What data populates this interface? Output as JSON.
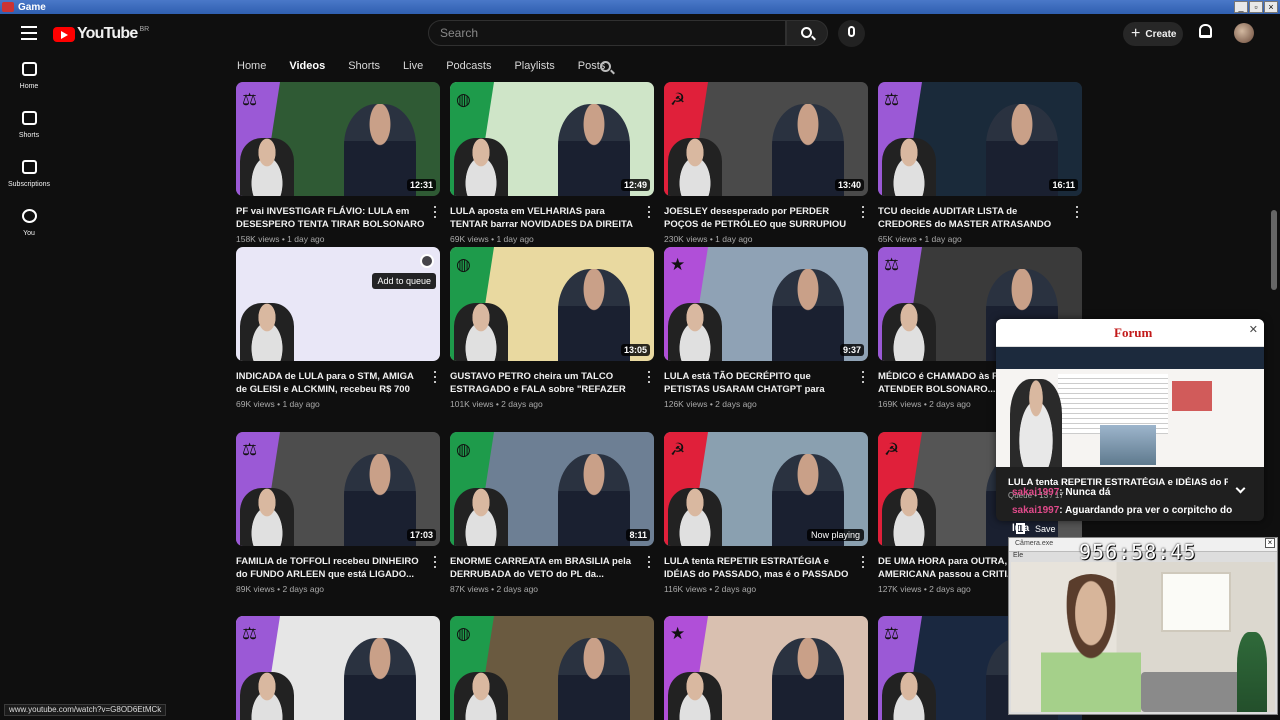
{
  "os": {
    "window_title": "Game"
  },
  "masthead": {
    "logo_text": "YouTube",
    "country_code": "BR",
    "search_placeholder": "Search",
    "create_label": "Create"
  },
  "sidebar": {
    "items": [
      {
        "label": "Home",
        "icon": "home-icon"
      },
      {
        "label": "Shorts",
        "icon": "shorts-icon"
      },
      {
        "label": "Subscriptions",
        "icon": "subscriptions-icon"
      },
      {
        "label": "You",
        "icon": "you-icon"
      }
    ]
  },
  "tabs": [
    "Home",
    "Videos",
    "Shorts",
    "Live",
    "Podcasts",
    "Playlists",
    "Posts"
  ],
  "active_tab": "Videos",
  "videos": [
    {
      "title": "PF vai INVESTIGAR FLÁVIO: LULA em DESESPERO TENTA TIRAR BOLSONARO d...",
      "meta": "158K views • 1 day ago",
      "duration": "12:31",
      "flag": "scales",
      "color": "#9b59d6",
      "bg": "#2f5a34"
    },
    {
      "title": "LULA aposta em VELHARIAS para TENTAR barrar NOVIDADES DA DIREITA no SENADO...",
      "meta": "69K views • 1 day ago",
      "duration": "12:49",
      "flag": "globe",
      "color": "#1e9b4b",
      "bg": "#cfe5c8"
    },
    {
      "title": "JOESLEY desesperado por PERDER POÇOS de PETRÓLEO que SURRUPIOU de...",
      "meta": "230K views • 1 day ago",
      "duration": "13:40",
      "flag": "hammer",
      "color": "#e0203a",
      "bg": "#4a4a4a"
    },
    {
      "title": "TCU decide AUDITAR LISTA de CREDORES do MASTER ATRASANDO pagamento pelo...",
      "meta": "65K views • 1 day ago",
      "duration": "16:11",
      "flag": "scales",
      "color": "#9b59d6",
      "bg": "#1a2a3a"
    },
    {
      "title": "INDICADA de LULA para o STM, AMIGA de GLEISI e ALCKMIN, recebeu R$ 700 MIL do...",
      "meta": "69K views • 1 day ago",
      "duration": "",
      "flag": "",
      "color": "#ffffff",
      "bg": "#e9e7f7",
      "hover": true,
      "add_to_queue": "Add to queue"
    },
    {
      "title": "GUSTAVO PETRO cheira um TALCO ESTRAGADO e FALA sobre \"REFAZER a...",
      "meta": "101K views • 2 days ago",
      "duration": "13:05",
      "flag": "globe",
      "color": "#1e9b4b",
      "bg": "#e9d9a0"
    },
    {
      "title": "LULA está TÃO DECRÉPITO que PETISTAS USARAM CHATGPT para COLOCAR...",
      "meta": "126K views • 2 days ago",
      "duration": "9:37",
      "flag": "star",
      "color": "#b04fd8",
      "bg": "#8fa2b5"
    },
    {
      "title": "MÉDICO é CHAMADO às PRESSAS para ATENDER BOLSONARO...",
      "meta": "169K views • 2 days ago",
      "duration": "",
      "flag": "scales",
      "color": "#9b59d6",
      "bg": "#3a3a3a"
    },
    {
      "title": "FAMILIA de TOFFOLI recebeu DINHEIRO do FUNDO ARLEEN que está LIGADO...",
      "meta": "89K views • 2 days ago",
      "duration": "17:03",
      "flag": "scales",
      "color": "#9b59d6",
      "bg": "#4d4d4d"
    },
    {
      "title": "ENORME CARREATA em BRASILIA pela DERRUBADA do VETO do PL da...",
      "meta": "87K views • 2 days ago",
      "duration": "8:11",
      "flag": "globe",
      "color": "#1e9b4b",
      "bg": "#6d7f94"
    },
    {
      "title": "LULA tenta REPETIR ESTRATÉGIA e IDÉIAS do PASSADO, mas é o PASSADO que vai...",
      "meta": "116K views • 2 days ago",
      "duration": "",
      "flag": "hammer",
      "color": "#e0203a",
      "bg": "#8aa0b0",
      "now_playing": "Now playing"
    },
    {
      "title": "DE UMA HORA para OUTRA, ... AMERICANA passou a CRITI...",
      "meta": "127K views • 2 days ago",
      "duration": "",
      "flag": "hammer",
      "color": "#e0203a",
      "bg": "#555555"
    },
    {
      "title": "",
      "meta": "",
      "duration": "",
      "flag": "scales",
      "color": "#9b59d6",
      "bg": "#e6e6e6"
    },
    {
      "title": "",
      "meta": "",
      "duration": "",
      "flag": "globe",
      "color": "#1e9b4b",
      "bg": "#6a5a40"
    },
    {
      "title": "",
      "meta": "",
      "duration": "",
      "flag": "star",
      "color": "#b04fd8",
      "bg": "#d9c0b0"
    },
    {
      "title": "",
      "meta": "",
      "duration": "",
      "flag": "scales",
      "color": "#9b59d6",
      "bg": "#1a2840"
    }
  ],
  "miniplayer": {
    "site_logo": "Forum",
    "title": "LULA tenta REPETIR ESTRATÉGIA e IDÉIAS do P...",
    "queue": "Queue • 13 / 17"
  },
  "chat": [
    {
      "user": "sakai1997",
      "message": ": Nunca dá"
    },
    {
      "user": "sakai1997",
      "message": ": Aguardando pra ver o corpitcho do"
    },
    {
      "user": "",
      "message": "lula"
    }
  ],
  "save_label": "Save",
  "camera": {
    "title": "Câmera.exe",
    "timer": "956:58:45",
    "file": "Ele"
  },
  "status_url": "www.youtube.com/watch?v=G8OD6EtMCk"
}
